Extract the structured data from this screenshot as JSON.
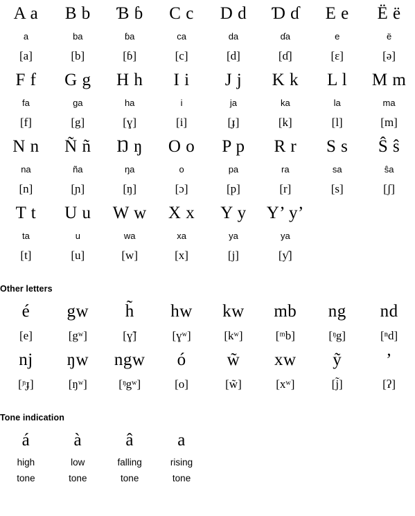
{
  "sections": {
    "main_alphabet": {
      "rows": [
        {
          "cells": [
            {
              "letter": "A a",
              "name": "a",
              "ipa": "[a]"
            },
            {
              "letter": "B b",
              "name": "ba",
              "ipa": "[b]"
            },
            {
              "letter": "Ɓ ɓ",
              "name": "ɓa",
              "ipa": "[ɓ]"
            },
            {
              "letter": "C c",
              "name": "ca",
              "ipa": "[c]"
            },
            {
              "letter": "D d",
              "name": "da",
              "ipa": "[d]"
            },
            {
              "letter": "Ɗ ɗ",
              "name": "ɗa",
              "ipa": "[ɗ]"
            },
            {
              "letter": "E e",
              "name": "e",
              "ipa": "[ɛ]"
            },
            {
              "letter": "Ë ë",
              "name": "ë",
              "ipa": "[ə]"
            }
          ]
        },
        {
          "cells": [
            {
              "letter": "F f",
              "name": "fa",
              "ipa": "[f]"
            },
            {
              "letter": "G g",
              "name": "ga",
              "ipa": "[g]"
            },
            {
              "letter": "H h",
              "name": "ha",
              "ipa": "[ɣ]"
            },
            {
              "letter": "I i",
              "name": "i",
              "ipa": "[i]"
            },
            {
              "letter": "J j",
              "name": "ja",
              "ipa": "[ɟ]"
            },
            {
              "letter": "K k",
              "name": "ka",
              "ipa": "[k]"
            },
            {
              "letter": "L l",
              "name": "la",
              "ipa": "[l]"
            },
            {
              "letter": "M m",
              "name": "ma",
              "ipa": "[m]"
            }
          ]
        },
        {
          "cells": [
            {
              "letter": "N n",
              "name": "na",
              "ipa": "[n]"
            },
            {
              "letter": "Ñ ñ",
              "name": "ña",
              "ipa": "[ɲ]"
            },
            {
              "letter": "Ŋ ŋ",
              "name": "ŋa",
              "ipa": "[ŋ]"
            },
            {
              "letter": "O o",
              "name": "o",
              "ipa": "[ɔ]"
            },
            {
              "letter": "P p",
              "name": "pa",
              "ipa": "[p]"
            },
            {
              "letter": "R r",
              "name": "ra",
              "ipa": "[r]"
            },
            {
              "letter": "S s",
              "name": "sa",
              "ipa": "[s]"
            },
            {
              "letter": "Ŝ ŝ",
              "name": "ŝa",
              "ipa": "[ʃ]"
            }
          ]
        },
        {
          "cells": [
            {
              "letter": "T t",
              "name": "ta",
              "ipa": "[t]"
            },
            {
              "letter": "U u",
              "name": "u",
              "ipa": "[u]"
            },
            {
              "letter": "W w",
              "name": "wa",
              "ipa": "[w]"
            },
            {
              "letter": "X x",
              "name": "xa",
              "ipa": "[x]"
            },
            {
              "letter": "Y y",
              "name": "ya",
              "ipa": "[j]"
            },
            {
              "letter": "Y’ y’",
              "name": "ya",
              "ipa": "[ƴ]"
            },
            {
              "letter": "",
              "name": "",
              "ipa": ""
            },
            {
              "letter": "",
              "name": "",
              "ipa": ""
            }
          ]
        }
      ]
    },
    "other_letters": {
      "heading": "Other letters",
      "rows": [
        {
          "cells": [
            {
              "letter": "é",
              "ipa": "[e]"
            },
            {
              "letter": "gw",
              "ipa": "[gʷ]"
            },
            {
              "letter": "h̃",
              "ipa": "[ɣ̃]"
            },
            {
              "letter": "hw",
              "ipa": "[ɣʷ]"
            },
            {
              "letter": "kw",
              "ipa": "[kʷ]"
            },
            {
              "letter": "mb",
              "ipa": "[ᵐb]"
            },
            {
              "letter": "ng",
              "ipa": "[ᵑg]"
            },
            {
              "letter": "nd",
              "ipa": "[ⁿd]"
            }
          ]
        },
        {
          "cells": [
            {
              "letter": "nj",
              "ipa": "[ᶮɟ]"
            },
            {
              "letter": "ŋw",
              "ipa": "[ŋʷ]"
            },
            {
              "letter": "ngw",
              "ipa": "[ᵑgʷ]"
            },
            {
              "letter": "ó",
              "ipa": "[o]"
            },
            {
              "letter": "w̃",
              "ipa": "[w̃]"
            },
            {
              "letter": "xw",
              "ipa": "[xʷ]"
            },
            {
              "letter": "ỹ",
              "ipa": "[j̃]"
            },
            {
              "letter": "’",
              "ipa": "[ʔ]"
            }
          ]
        }
      ]
    },
    "tone_indication": {
      "heading": "Tone indication",
      "cells": [
        {
          "letter": "á",
          "desc_line1": "high",
          "desc_line2": "tone"
        },
        {
          "letter": "à",
          "desc_line1": "low",
          "desc_line2": "tone"
        },
        {
          "letter": "â",
          "desc_line1": "falling",
          "desc_line2": "tone"
        },
        {
          "letter": "a",
          "desc_line1": "rising",
          "desc_line2": "tone"
        }
      ]
    }
  }
}
